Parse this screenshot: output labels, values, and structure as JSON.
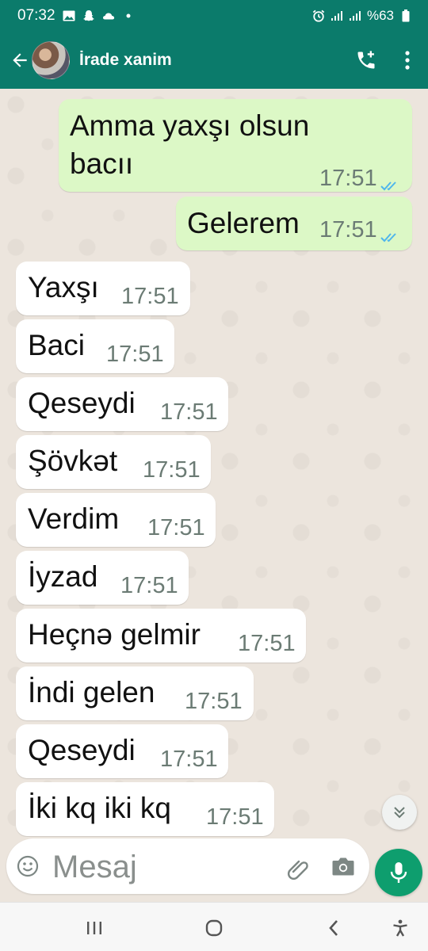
{
  "status_bar": {
    "time": "07:32",
    "battery": "%63",
    "icons_left": [
      "image-icon",
      "snapchat-icon",
      "cloud-icon",
      "dot-icon"
    ],
    "icons_right": [
      "alarm-icon",
      "signal-icon",
      "signal-icon",
      "battery-icon"
    ]
  },
  "header": {
    "contact_name": "İrade xanim",
    "icons": [
      "back-arrow-icon",
      "avatar",
      "add-call-icon",
      "more-vert-icon"
    ]
  },
  "colors": {
    "header_bg": "#0b7b6b",
    "outgoing_bubble": "#dcf8c6",
    "incoming_bubble": "#ffffff",
    "chat_bg": "#ece5dd",
    "read_ticks": "#4fb6ec",
    "mic_button": "#0e9e6e"
  },
  "messages": [
    {
      "direction": "out",
      "lines": [
        "Amma yaxşı olsun",
        "bacıı"
      ],
      "time": "17:51",
      "status": "read"
    },
    {
      "direction": "out",
      "lines": [
        "Gelerem"
      ],
      "time": "17:51",
      "status": "read"
    },
    {
      "direction": "in",
      "lines": [
        "Yaxşı"
      ],
      "time": "17:51"
    },
    {
      "direction": "in",
      "lines": [
        "Baci"
      ],
      "time": "17:51"
    },
    {
      "direction": "in",
      "lines": [
        "Qeseydi"
      ],
      "time": "17:51"
    },
    {
      "direction": "in",
      "lines": [
        "Şövkət"
      ],
      "time": "17:51"
    },
    {
      "direction": "in",
      "lines": [
        "Verdim"
      ],
      "time": "17:51"
    },
    {
      "direction": "in",
      "lines": [
        "İyzad"
      ],
      "time": "17:51"
    },
    {
      "direction": "in",
      "lines": [
        "Heçnə gelmir"
      ],
      "time": "17:51"
    },
    {
      "direction": "in",
      "lines": [
        "İndi gelen"
      ],
      "time": "17:51"
    },
    {
      "direction": "in",
      "lines": [
        "Qeseydi"
      ],
      "time": "17:51"
    },
    {
      "direction": "in",
      "lines": [
        "İki kq iki kq"
      ],
      "time": "17:51"
    }
  ],
  "composer": {
    "placeholder": "Mesaj",
    "icons": [
      "emoji-icon",
      "attach-icon",
      "camera-icon",
      "mic-icon"
    ]
  },
  "scroll_button_icon": "chevron-double-down-icon",
  "nav_bar": {
    "icons": [
      "recent-apps-icon",
      "home-icon",
      "back-icon",
      "accessibility-icon"
    ]
  }
}
